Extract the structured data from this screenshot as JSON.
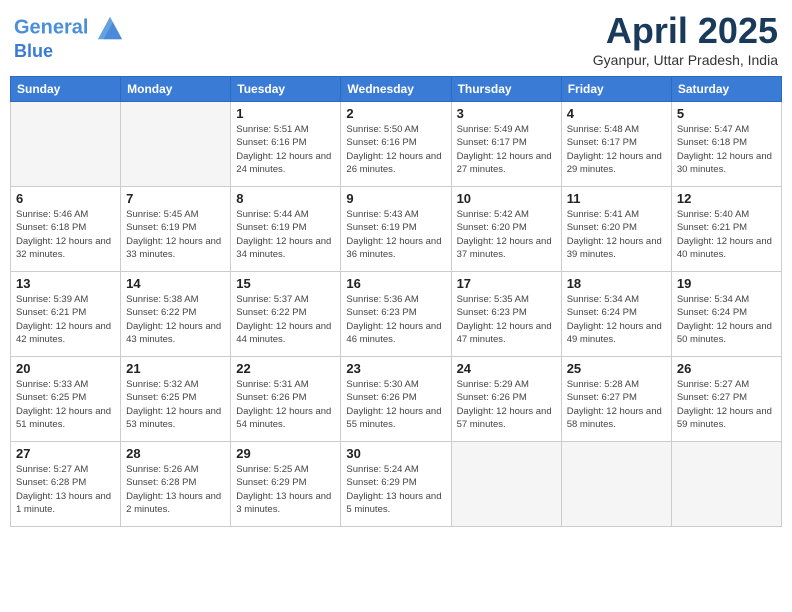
{
  "header": {
    "logo_line1": "General",
    "logo_line2": "Blue",
    "month_title": "April 2025",
    "subtitle": "Gyanpur, Uttar Pradesh, India"
  },
  "days_of_week": [
    "Sunday",
    "Monday",
    "Tuesday",
    "Wednesday",
    "Thursday",
    "Friday",
    "Saturday"
  ],
  "weeks": [
    [
      {
        "day": "",
        "info": ""
      },
      {
        "day": "",
        "info": ""
      },
      {
        "day": "1",
        "info": "Sunrise: 5:51 AM\nSunset: 6:16 PM\nDaylight: 12 hours and 24 minutes."
      },
      {
        "day": "2",
        "info": "Sunrise: 5:50 AM\nSunset: 6:16 PM\nDaylight: 12 hours and 26 minutes."
      },
      {
        "day": "3",
        "info": "Sunrise: 5:49 AM\nSunset: 6:17 PM\nDaylight: 12 hours and 27 minutes."
      },
      {
        "day": "4",
        "info": "Sunrise: 5:48 AM\nSunset: 6:17 PM\nDaylight: 12 hours and 29 minutes."
      },
      {
        "day": "5",
        "info": "Sunrise: 5:47 AM\nSunset: 6:18 PM\nDaylight: 12 hours and 30 minutes."
      }
    ],
    [
      {
        "day": "6",
        "info": "Sunrise: 5:46 AM\nSunset: 6:18 PM\nDaylight: 12 hours and 32 minutes."
      },
      {
        "day": "7",
        "info": "Sunrise: 5:45 AM\nSunset: 6:19 PM\nDaylight: 12 hours and 33 minutes."
      },
      {
        "day": "8",
        "info": "Sunrise: 5:44 AM\nSunset: 6:19 PM\nDaylight: 12 hours and 34 minutes."
      },
      {
        "day": "9",
        "info": "Sunrise: 5:43 AM\nSunset: 6:19 PM\nDaylight: 12 hours and 36 minutes."
      },
      {
        "day": "10",
        "info": "Sunrise: 5:42 AM\nSunset: 6:20 PM\nDaylight: 12 hours and 37 minutes."
      },
      {
        "day": "11",
        "info": "Sunrise: 5:41 AM\nSunset: 6:20 PM\nDaylight: 12 hours and 39 minutes."
      },
      {
        "day": "12",
        "info": "Sunrise: 5:40 AM\nSunset: 6:21 PM\nDaylight: 12 hours and 40 minutes."
      }
    ],
    [
      {
        "day": "13",
        "info": "Sunrise: 5:39 AM\nSunset: 6:21 PM\nDaylight: 12 hours and 42 minutes."
      },
      {
        "day": "14",
        "info": "Sunrise: 5:38 AM\nSunset: 6:22 PM\nDaylight: 12 hours and 43 minutes."
      },
      {
        "day": "15",
        "info": "Sunrise: 5:37 AM\nSunset: 6:22 PM\nDaylight: 12 hours and 44 minutes."
      },
      {
        "day": "16",
        "info": "Sunrise: 5:36 AM\nSunset: 6:23 PM\nDaylight: 12 hours and 46 minutes."
      },
      {
        "day": "17",
        "info": "Sunrise: 5:35 AM\nSunset: 6:23 PM\nDaylight: 12 hours and 47 minutes."
      },
      {
        "day": "18",
        "info": "Sunrise: 5:34 AM\nSunset: 6:24 PM\nDaylight: 12 hours and 49 minutes."
      },
      {
        "day": "19",
        "info": "Sunrise: 5:34 AM\nSunset: 6:24 PM\nDaylight: 12 hours and 50 minutes."
      }
    ],
    [
      {
        "day": "20",
        "info": "Sunrise: 5:33 AM\nSunset: 6:25 PM\nDaylight: 12 hours and 51 minutes."
      },
      {
        "day": "21",
        "info": "Sunrise: 5:32 AM\nSunset: 6:25 PM\nDaylight: 12 hours and 53 minutes."
      },
      {
        "day": "22",
        "info": "Sunrise: 5:31 AM\nSunset: 6:26 PM\nDaylight: 12 hours and 54 minutes."
      },
      {
        "day": "23",
        "info": "Sunrise: 5:30 AM\nSunset: 6:26 PM\nDaylight: 12 hours and 55 minutes."
      },
      {
        "day": "24",
        "info": "Sunrise: 5:29 AM\nSunset: 6:26 PM\nDaylight: 12 hours and 57 minutes."
      },
      {
        "day": "25",
        "info": "Sunrise: 5:28 AM\nSunset: 6:27 PM\nDaylight: 12 hours and 58 minutes."
      },
      {
        "day": "26",
        "info": "Sunrise: 5:27 AM\nSunset: 6:27 PM\nDaylight: 12 hours and 59 minutes."
      }
    ],
    [
      {
        "day": "27",
        "info": "Sunrise: 5:27 AM\nSunset: 6:28 PM\nDaylight: 13 hours and 1 minute."
      },
      {
        "day": "28",
        "info": "Sunrise: 5:26 AM\nSunset: 6:28 PM\nDaylight: 13 hours and 2 minutes."
      },
      {
        "day": "29",
        "info": "Sunrise: 5:25 AM\nSunset: 6:29 PM\nDaylight: 13 hours and 3 minutes."
      },
      {
        "day": "30",
        "info": "Sunrise: 5:24 AM\nSunset: 6:29 PM\nDaylight: 13 hours and 5 minutes."
      },
      {
        "day": "",
        "info": ""
      },
      {
        "day": "",
        "info": ""
      },
      {
        "day": "",
        "info": ""
      }
    ]
  ]
}
